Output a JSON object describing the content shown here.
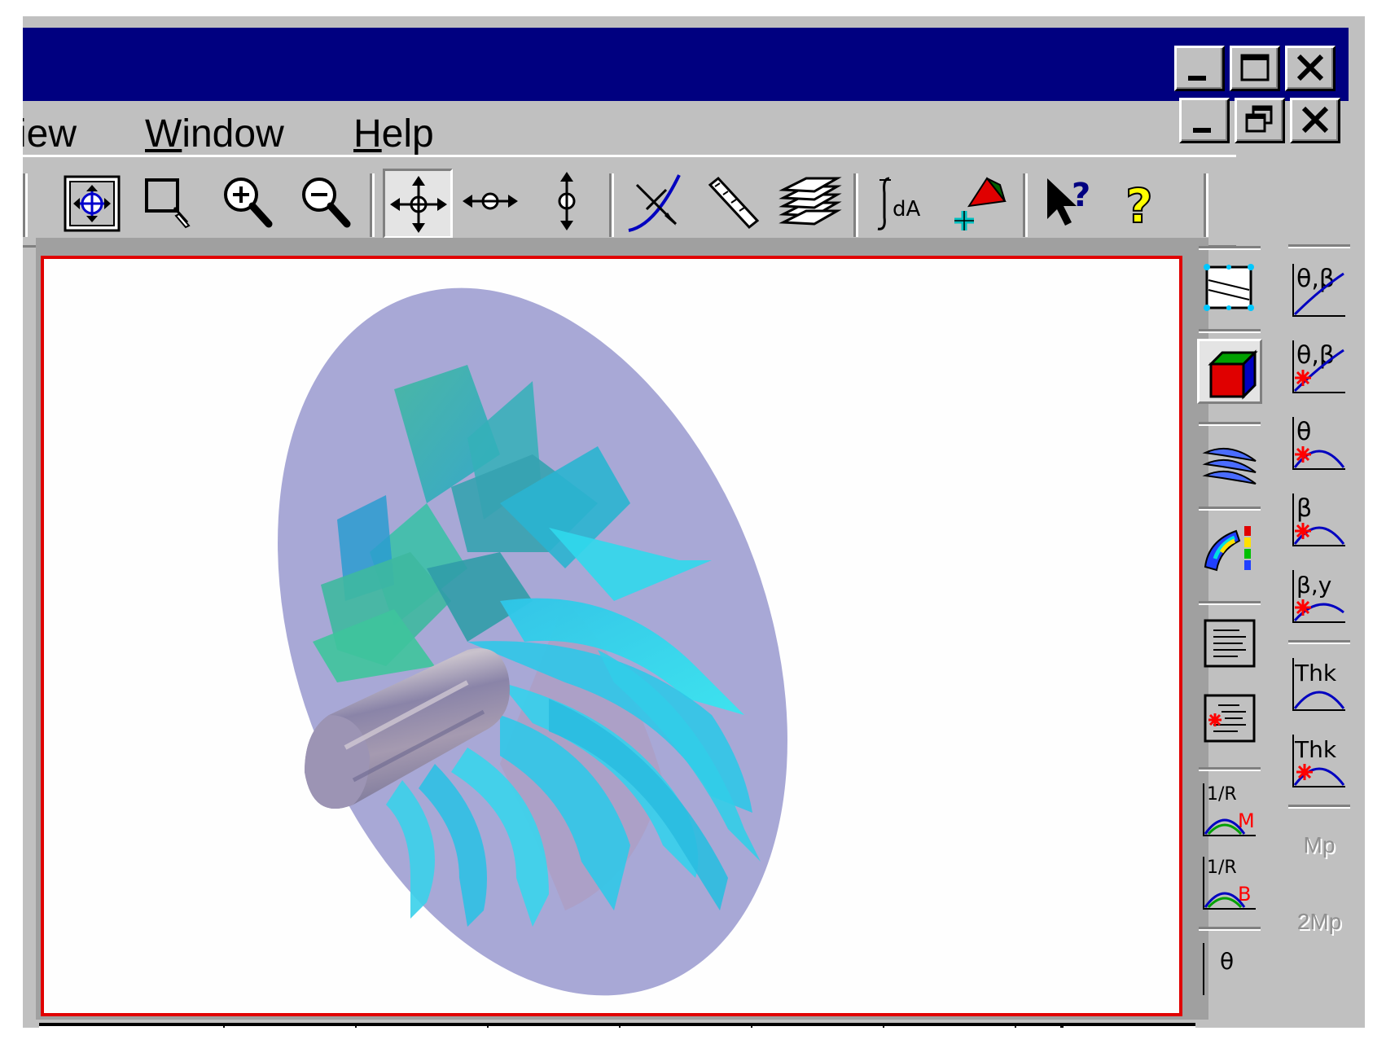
{
  "window": {
    "titlebar_color": "#000080",
    "caption_buttons": [
      "minimize-icon",
      "maximize-icon",
      "close-icon"
    ]
  },
  "menubar": {
    "items": [
      {
        "label": "View",
        "display": "iew",
        "mnemonic": ""
      },
      {
        "label": "Window",
        "display": "indow",
        "mnemonic": "W"
      },
      {
        "label": "Help",
        "display": "elp",
        "mnemonic": "H"
      }
    ],
    "doc_buttons": [
      "minimize-icon",
      "restore-icon",
      "close-icon"
    ]
  },
  "toolbar": {
    "buttons": [
      {
        "name": "zoom-fit-icon",
        "pressed": false
      },
      {
        "name": "zoom-window-icon",
        "pressed": false
      },
      {
        "name": "zoom-in-icon",
        "pressed": false
      },
      {
        "name": "zoom-out-icon",
        "pressed": false
      },
      {
        "name": "pan-icon",
        "pressed": true
      },
      {
        "name": "pan-horizontal-icon",
        "pressed": false
      },
      {
        "name": "pan-vertical-icon",
        "pressed": false
      },
      {
        "name": "intersect-curve-icon",
        "pressed": false
      },
      {
        "name": "measure-icon",
        "pressed": false
      },
      {
        "name": "layers-icon",
        "pressed": false
      },
      {
        "name": "area-integral-icon",
        "pressed": false
      },
      {
        "name": "add-color-icon",
        "pressed": false
      },
      {
        "name": "context-help-icon",
        "pressed": false
      },
      {
        "name": "help-icon",
        "pressed": false
      }
    ]
  },
  "viewport": {
    "border_color": "#e00000",
    "content": "3d-impeller-render"
  },
  "palette_left": {
    "items": [
      {
        "name": "meridional-view-icon"
      },
      {
        "name": "3d-solid-view-icon",
        "pressed": true
      },
      {
        "name": "blade-sections-icon"
      },
      {
        "name": "color-contour-icon"
      },
      {
        "name": "text-report-icon"
      },
      {
        "name": "text-report-edit-icon"
      },
      {
        "name": "loading-m-icon",
        "label": "1/R",
        "sub": "M"
      },
      {
        "name": "loading-b-icon",
        "label": "1/R",
        "sub": "B"
      }
    ]
  },
  "palette_right": {
    "items": [
      {
        "name": "theta-beta-icon",
        "label": "θ,β"
      },
      {
        "name": "theta-beta-edit-icon",
        "label": "θ,β"
      },
      {
        "name": "theta-edit-icon",
        "label": "θ"
      },
      {
        "name": "beta-edit-icon",
        "label": "β"
      },
      {
        "name": "beta-y-edit-icon",
        "label": "β,y"
      },
      {
        "name": "thickness-icon",
        "label": "Thk"
      },
      {
        "name": "thickness-edit-icon",
        "label": "Thk"
      },
      {
        "name": "mp-icon",
        "label": "Mp",
        "disabled": true
      },
      {
        "name": "2mp-icon",
        "label": "2Mp",
        "disabled": true
      }
    ]
  }
}
